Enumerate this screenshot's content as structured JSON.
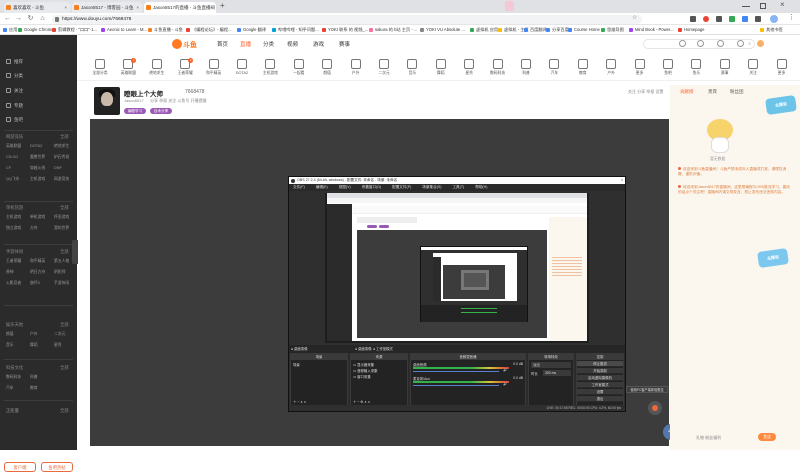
{
  "browser": {
    "tabs": [
      {
        "label": "喜欢喜欢 - 斗鱼",
        "active": false,
        "favicon_color": "#f58220"
      },
      {
        "label": "Jason8517 - 博客园 - 斗鱼",
        "active": false,
        "favicon_color": "#f58220"
      },
      {
        "label": "Jason8517的直播 - 斗鱼直播间",
        "active": true,
        "favicon_color": "#f58220"
      }
    ],
    "url": "https://www.douyu.com/7668478",
    "bookmarks": [
      {
        "label": "应用",
        "color": "#4285f4"
      },
      {
        "label": "Google Chrome",
        "color": "#34a853"
      },
      {
        "label": "剪辑教程 - \"口口\"·1...",
        "color": "#e94235"
      },
      {
        "label": "Aeonic to Learn - M...",
        "color": "#a142f4"
      },
      {
        "label": "斗鱼直播 - 斗鱼",
        "color": "#f58220"
      },
      {
        "label": "《编程论坛》- 编程...",
        "color": "#e94235"
      },
      {
        "label": "Google 翻译",
        "color": "#4285f4"
      },
      {
        "label": "哔哩哔哩 - 知乎问题...",
        "color": "#00a1d6"
      },
      {
        "label": "YOKI 联系 的 视频_...",
        "color": "#e94235"
      },
      {
        "label": "sakura 的 b站 主页 - ...",
        "color": "#fb7299"
      },
      {
        "label": "YOKI VU Absolute ...",
        "color": "#888888"
      },
      {
        "label": "虚拟机 应用",
        "color": "#34a853"
      },
      {
        "label": "虚拟机 - 主页",
        "color": "#fbbc04"
      },
      {
        "label": "百度翻译",
        "color": "#4285f4"
      },
      {
        "label": "分享百度",
        "color": "#4285f4"
      },
      {
        "label": "Course Home",
        "color": "#4285f4"
      },
      {
        "label": "思维导图",
        "color": "#34a853"
      },
      {
        "label": "Mind Book - Power...",
        "color": "#a142f4"
      },
      {
        "label": "Homepage",
        "color": "#e94235"
      },
      {
        "label": "其他书签",
        "color": "#fbbc04"
      }
    ]
  },
  "sidebar": {
    "items": [
      {
        "label": "推荐"
      },
      {
        "label": "分类"
      },
      {
        "label": "关注"
      },
      {
        "label": "专题"
      },
      {
        "label": "鱼吧"
      }
    ],
    "sections": [
      {
        "title": "网游竞技",
        "more": "全部",
        "cells": [
          "英雄联盟",
          "DOTA2",
          "绝地求生",
          "CS:GO",
          "魔兽世界",
          "炉石传说",
          "CF",
          "穿越火线",
          "DNF",
          "QQ飞车",
          "主机游戏",
          "网游竞技"
        ]
      },
      {
        "title": "单机热游",
        "more": "全部",
        "cells": [
          "主机游戏",
          "单机游戏",
          "怀旧游戏",
          "独立游戏",
          "方舟",
          "我的世界"
        ]
      },
      {
        "title": "手游休闲",
        "more": "全部",
        "cells": [
          "王者荣耀",
          "和平精英",
          "第五人格",
          "原神",
          "明日方舟",
          "阴阳师",
          "火影忍者",
          "崩坏3",
          "手游休闲"
        ]
      },
      {
        "title": "娱乐天地",
        "more": "全部",
        "cells": [
          "颜值",
          "户外",
          "二次元",
          "音乐",
          "舞蹈",
          "星秀"
        ]
      },
      {
        "title": "科技文化",
        "more": "全部",
        "cells": [
          "数码科技",
          "科普",
          "汽车",
          "教育"
        ]
      },
      {
        "title": "正能量",
        "more": "全部",
        "cells": []
      }
    ],
    "bottom_left": "客户端",
    "bottom_right": "鱼吧热帖"
  },
  "header": {
    "logo_text": "斗鱼",
    "nav": [
      {
        "label": "首页",
        "on": false
      },
      {
        "label": "直播",
        "on": true
      },
      {
        "label": "分类",
        "on": false
      },
      {
        "label": "视频",
        "on": false
      },
      {
        "label": "游戏",
        "on": false
      },
      {
        "label": "赛事",
        "on": false
      }
    ]
  },
  "categories": [
    {
      "label": "全部分类",
      "dot": ""
    },
    {
      "label": "英雄联盟",
      "dot": "1"
    },
    {
      "label": "绝地求生",
      "dot": ""
    },
    {
      "label": "王者荣耀",
      "dot": "2"
    },
    {
      "label": "和平精英",
      "dot": ""
    },
    {
      "label": "DOTA2",
      "dot": ""
    },
    {
      "label": "主机游戏",
      "dot": ""
    },
    {
      "label": "一起看",
      "dot": ""
    },
    {
      "label": "颜值",
      "dot": ""
    },
    {
      "label": "户外",
      "dot": ""
    },
    {
      "label": "二次元",
      "dot": ""
    },
    {
      "label": "音乐",
      "dot": ""
    },
    {
      "label": "舞蹈",
      "dot": ""
    },
    {
      "label": "星秀",
      "dot": ""
    },
    {
      "label": "数码科技",
      "dot": ""
    },
    {
      "label": "科普",
      "dot": ""
    },
    {
      "label": "汽车",
      "dot": ""
    },
    {
      "label": "教育",
      "dot": ""
    },
    {
      "label": "户外",
      "dot": ""
    },
    {
      "label": "更多",
      "dot": ""
    },
    {
      "label": "鱼吧",
      "dot": ""
    },
    {
      "label": "鱼乐",
      "dot": ""
    },
    {
      "label": "赛事",
      "dot": ""
    },
    {
      "label": "关注",
      "dot": ""
    },
    {
      "label": "更多",
      "dot": ""
    }
  ],
  "streamer": {
    "name": "瞪眼上个大师",
    "room_id": "7668478",
    "sub_line": "Jason8517",
    "sub_line2": "分享 举报 关注 斗鱼号 开播提醒",
    "tags": [
      {
        "label": "编程学习",
        "color": "#9b59b6"
      },
      {
        "label": "技术分享",
        "color": "#9b59b6"
      }
    ],
    "right_info": "关注 分享 举报 设置"
  },
  "obs": {
    "title": "OBS 27.2.4 (64-bit, windows) - 配置文件: 未命名 - 场景: 未命名",
    "menu": [
      "文件(F)",
      "编辑(E)",
      "视图(V)",
      "停靠窗口(D)",
      "配置文件(P)",
      "场景集合(S)",
      "工具(T)",
      "帮助(H)"
    ],
    "scene_bar": [
      "桌面录像",
      "工作室模式"
    ],
    "docks": {
      "scenes": {
        "title": "场景",
        "items": [
          "场景"
        ]
      },
      "sources": {
        "title": "来源",
        "items": [
          "显示器采集",
          "音频输入采集",
          "窗口采集"
        ]
      },
      "mixer": {
        "title": "音频混音器",
        "tracks": [
          {
            "name": "桌面音频",
            "level": "0.0 dB"
          },
          {
            "name": "麦克风/Aux",
            "level": "0.0 dB"
          }
        ]
      },
      "transitions": {
        "title": "转场特效",
        "type": "淡出",
        "duration_label": "时长",
        "duration": "300 ms"
      },
      "controls": {
        "title": "控制",
        "buttons": [
          "停止推流",
          "开始录制",
          "启动虚拟摄像机",
          "工作室模式",
          "设置",
          "退出"
        ]
      }
    },
    "status": "LIVE: 00:17:55  REC: 00:00:00  CPU: 4.2%, 60.00 fps"
  },
  "floating": {
    "tooltip": "使用PC客户端体验更佳",
    "viewer_count": "47"
  },
  "right_panel": {
    "tabs": [
      {
        "label": "贡献榜",
        "on": true
      },
      {
        "label": "贵宾",
        "on": false
      },
      {
        "label": "粉丝团",
        "on": false
      }
    ],
    "badge": "主播说",
    "note": "暂无数据",
    "messages": [
      "欢迎来到斗鱼直播间！斗鱼严禁未成年人直播或打赏，请理性消费，谨防诈骗。",
      "欢迎来到Jason8517的直播间，这里是编程与OBS推流学习，喜欢的话点个关注吧！直播间内请文明发言，禁止发布违法违规内容。"
    ],
    "send_button": "发送",
    "footer": "礼物 粉丝福利"
  }
}
